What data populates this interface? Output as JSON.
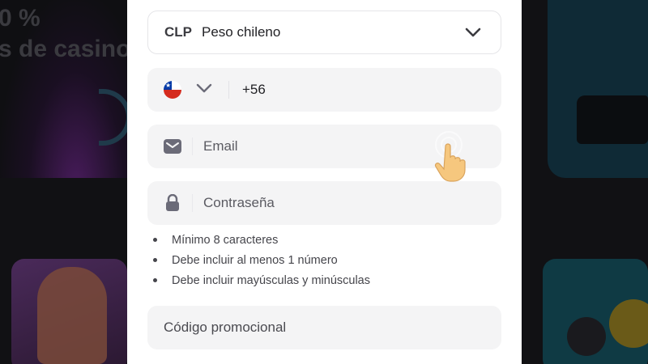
{
  "background": {
    "headline_lines": [
      "0 %",
      "s de casino"
    ]
  },
  "form": {
    "currency": {
      "code": "CLP",
      "name": "Peso chileno",
      "icon": "chevron-down-icon"
    },
    "phone": {
      "country_flag": "chile-flag-icon",
      "prefix": "+56",
      "icon": "chevron-down-icon"
    },
    "email": {
      "placeholder": "Email",
      "icon": "envelope-icon"
    },
    "password": {
      "placeholder": "Contraseña",
      "icon": "lock-icon"
    },
    "password_rules": [
      "Mínimo 8 caracteres",
      "Debe incluir al menos 1 número",
      "Debe incluir mayúsculas y minúsculas"
    ],
    "promo": {
      "placeholder": "Código promocional"
    }
  },
  "colors": {
    "panel": "#ffffff",
    "field": "#f4f4f5",
    "text": "#222226",
    "muted": "#5b5b62",
    "icon": "#6b6b78"
  }
}
